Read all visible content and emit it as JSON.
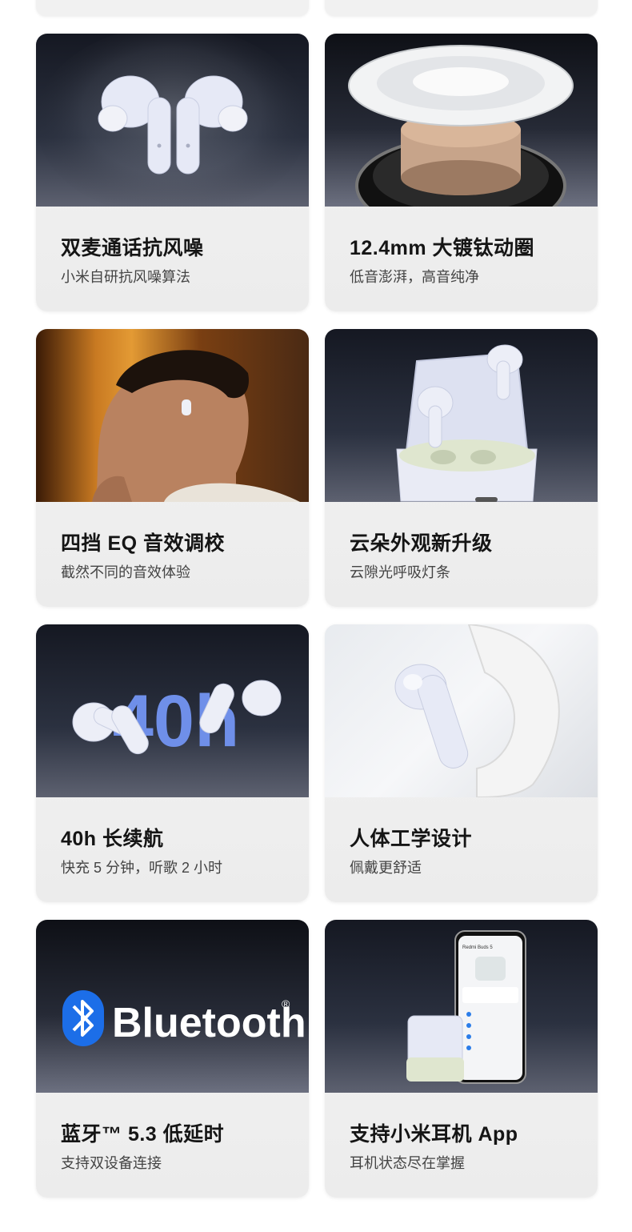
{
  "cards": [
    {
      "title": "双麦通话抗风噪",
      "subtitle": "小米自研抗风噪算法"
    },
    {
      "title": "12.4mm 大镀钛动圈",
      "subtitle": "低音澎湃，高音纯净"
    },
    {
      "title": "四挡 EQ 音效调校",
      "subtitle": "截然不同的音效体验"
    },
    {
      "title": "云朵外观新升级",
      "subtitle": "云隙光呼吸灯条"
    },
    {
      "title": "40h 长续航",
      "subtitle": "快充 5 分钟，听歌 2 小时"
    },
    {
      "title": "人体工学设计",
      "subtitle": "佩戴更舒适"
    },
    {
      "title": "蓝牙™ 5.3 低延时",
      "subtitle": "支持双设备连接"
    },
    {
      "title": "支持小米耳机 App",
      "subtitle": "耳机状态尽在掌握"
    }
  ],
  "images": {
    "battery_text": "40h",
    "bluetooth_word": "Bluetooth",
    "bluetooth_mark": "®",
    "phone_app_title": "Redmi Buds 5"
  },
  "colors": {
    "bluetooth_blue": "#1c6ee8",
    "card_bg": "#efefef",
    "title_text": "#151515",
    "subtitle_text": "#444444"
  }
}
